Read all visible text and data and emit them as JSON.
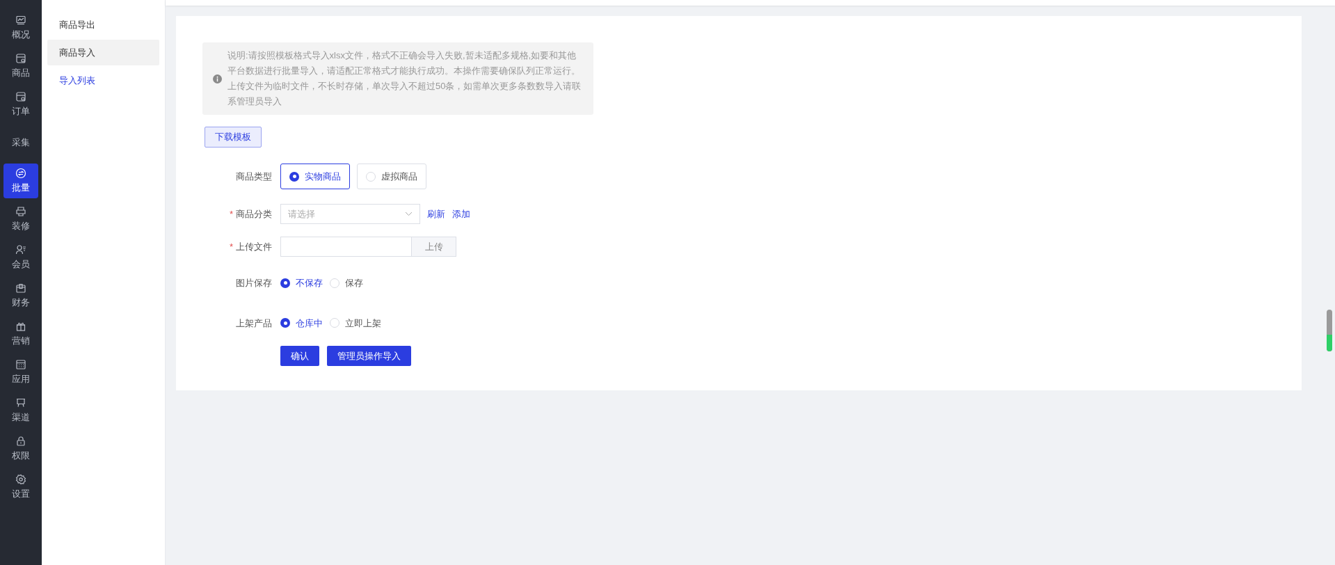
{
  "nav": [
    {
      "label": "概况",
      "selected": false
    },
    {
      "label": "商品",
      "selected": false
    },
    {
      "label": "订单",
      "selected": false
    },
    {
      "label": "采集",
      "selected": false
    },
    {
      "label": "批量",
      "selected": true
    },
    {
      "label": "装修",
      "selected": false
    },
    {
      "label": "会员",
      "selected": false
    },
    {
      "label": "财务",
      "selected": false
    },
    {
      "label": "营销",
      "selected": false
    },
    {
      "label": "应用",
      "selected": false
    },
    {
      "label": "渠道",
      "selected": false
    },
    {
      "label": "权限",
      "selected": false
    },
    {
      "label": "设置",
      "selected": false
    }
  ],
  "subnav": [
    {
      "label": "商品导出",
      "selected": false,
      "kind": "item"
    },
    {
      "label": "商品导入",
      "selected": true,
      "kind": "item"
    },
    {
      "label": "导入列表",
      "selected": false,
      "kind": "link"
    }
  ],
  "notice": "说明:请按照模板格式导入xlsx文件，格式不正确会导入失败,暂未适配多规格,如要和其他平台数据进行批量导入，请适配正常格式才能执行成功。本操作需要确保队列正常运行。上传文件为临时文件，不长时存储，单次导入不超过50条，如需单次更多条数数导入请联系管理员导入",
  "download_button": "下载模板",
  "form": {
    "product_type": {
      "label": "商品类型",
      "options": [
        {
          "label": "实物商品",
          "selected": true
        },
        {
          "label": "虚拟商品",
          "selected": false
        }
      ]
    },
    "category": {
      "label": "商品分类",
      "required_mark": "*",
      "placeholder": "请选择",
      "links": [
        "刷新",
        "添加"
      ]
    },
    "upload": {
      "label": "上传文件",
      "required_mark": "*",
      "button": "上传"
    },
    "image_save": {
      "label": "图片保存",
      "options": [
        {
          "label": "不保存",
          "selected": true
        },
        {
          "label": "保存",
          "selected": false
        }
      ]
    },
    "listing": {
      "label": "上架产品",
      "options": [
        {
          "label": "仓库中",
          "selected": true
        },
        {
          "label": "立即上架",
          "selected": false
        }
      ]
    }
  },
  "buttons": [
    "确认",
    "管理员操作导入"
  ]
}
